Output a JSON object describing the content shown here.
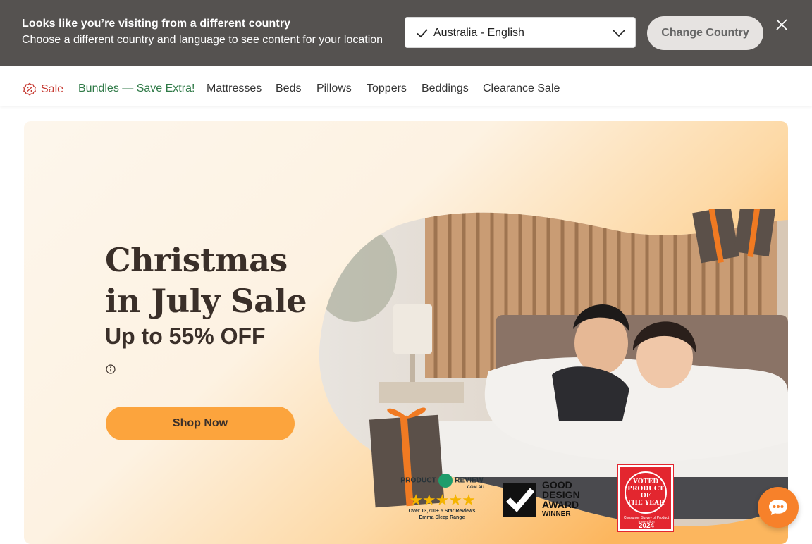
{
  "country_banner": {
    "title": "Looks like you’re visiting from a different country",
    "subtitle": "Choose a different country and language to see content for your location",
    "selected_country": "Australia - English",
    "change_button": "Change Country"
  },
  "nav": {
    "items": [
      {
        "label": "Sale"
      },
      {
        "label": "Bundles — Save Extra!"
      },
      {
        "label": "Mattresses"
      },
      {
        "label": "Beds"
      },
      {
        "label": "Pillows"
      },
      {
        "label": "Toppers"
      },
      {
        "label": "Beddings"
      },
      {
        "label": "Clearance Sale"
      }
    ]
  },
  "hero": {
    "title": "Christmas in July Sale",
    "subtitle": "Up to 55% OFF",
    "cta": "Shop Now"
  },
  "badges": {
    "product_review": {
      "title_a": "PRODUCT",
      "title_b": "REVIEW",
      "domain": ".COM.AU",
      "stars": "★★★★★",
      "note_line1": "Over 13,700+ 5 Star Reviews",
      "note_line2": "Emma Sleep Range"
    },
    "good_design": {
      "line1": "GOOD",
      "line2": "DESIGN",
      "line3": "AWARD",
      "line4": "WINNER"
    },
    "poty": {
      "line1": "VOTED",
      "line2": "PRODUCT",
      "line3": "OF",
      "line4": "THE YEAR",
      "note": "Consumer Survey of Product Innovation",
      "year": "2024"
    }
  },
  "colors": {
    "banner_bg": "#555250",
    "sale_red": "#c63a32",
    "bundles_green": "#2f7a47",
    "cta_orange": "#fca43d",
    "chat_orange": "#f7812a"
  }
}
